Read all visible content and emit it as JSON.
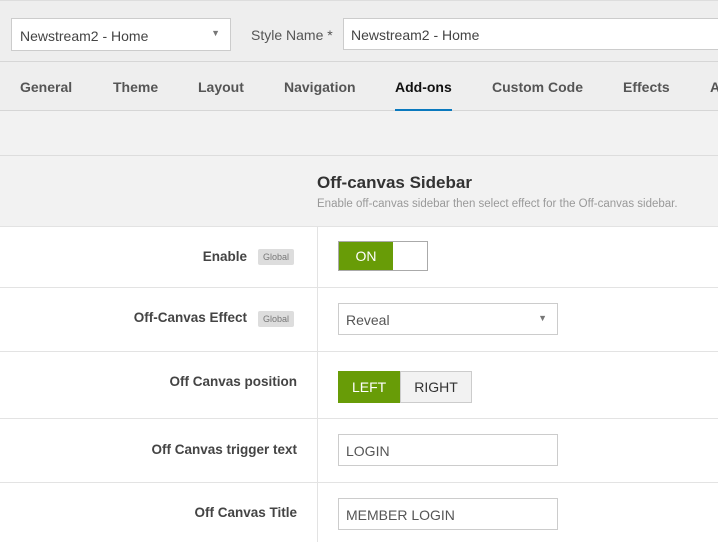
{
  "header": {
    "style_select": "Newstream2 - Home",
    "style_name_label": "Style Name *",
    "style_name_value": "Newstream2 - Home"
  },
  "tabs": [
    {
      "label": "General"
    },
    {
      "label": "Theme"
    },
    {
      "label": "Layout"
    },
    {
      "label": "Navigation"
    },
    {
      "label": "Add-ons",
      "active": true
    },
    {
      "label": "Custom Code"
    },
    {
      "label": "Effects"
    },
    {
      "label": "A"
    }
  ],
  "section": {
    "title": "Off-canvas Sidebar",
    "description": "Enable off-canvas sidebar then select effect for the Off-canvas sidebar."
  },
  "fields": {
    "enable": {
      "label": "Enable",
      "badge": "Global",
      "value": "ON"
    },
    "effect": {
      "label": "Off-Canvas Effect",
      "badge": "Global",
      "value": "Reveal"
    },
    "position": {
      "label": "Off Canvas position",
      "options": [
        "LEFT",
        "RIGHT"
      ],
      "selected": "LEFT"
    },
    "trigger": {
      "label": "Off Canvas trigger text",
      "value": "LOGIN"
    },
    "title": {
      "label": "Off Canvas Title",
      "value": "MEMBER LOGIN"
    }
  },
  "colors": {
    "accent": "#689c07",
    "tab_underline": "#0a79be"
  }
}
